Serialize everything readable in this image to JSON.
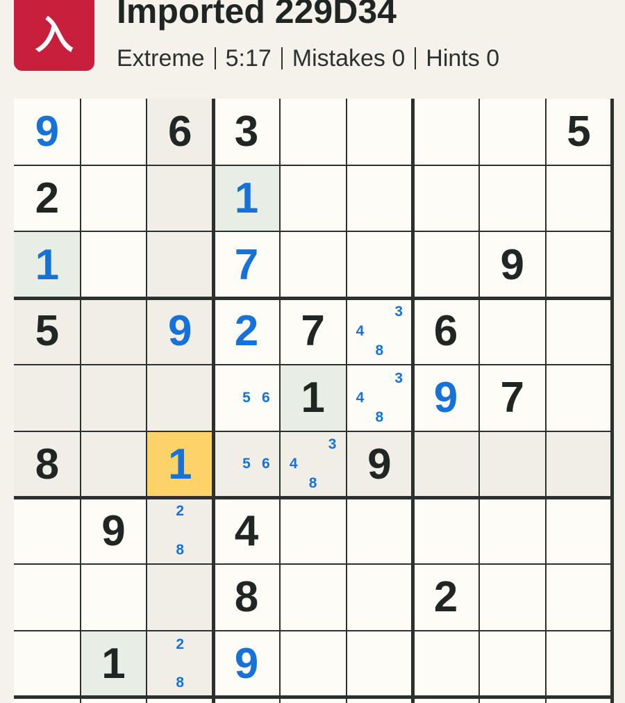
{
  "app": {
    "logo_glyph": "入",
    "title": "Imported 229D34",
    "difficulty": "Extreme",
    "timer": "5:17",
    "mistakes": "Mistakes 0",
    "hints": "Hints 0"
  },
  "colors": {
    "logo_bg": "#c8203c",
    "given_digit": "#1f2623",
    "user_digit": "#1672d9",
    "selected_cell": "#fcd269",
    "peer_highlight": "#f0eee7",
    "same_number_highlight": "#e8eee6"
  },
  "board": {
    "selected": [
      5,
      2
    ],
    "cells": [
      [
        {
          "v": "9",
          "t": "user"
        },
        {
          "v": "",
          "t": "empty"
        },
        {
          "v": "6",
          "t": "given",
          "hl": "peer"
        },
        {
          "v": "3",
          "t": "given"
        },
        {
          "v": "",
          "t": "empty"
        },
        {
          "v": "",
          "t": "empty"
        },
        {
          "v": "",
          "t": "empty"
        },
        {
          "v": "",
          "t": "empty"
        },
        {
          "v": "5",
          "t": "given"
        }
      ],
      [
        {
          "v": "2",
          "t": "given"
        },
        {
          "v": "",
          "t": "empty"
        },
        {
          "v": "",
          "t": "empty",
          "hl": "peer"
        },
        {
          "v": "1",
          "t": "user",
          "hl": "same"
        },
        {
          "v": "",
          "t": "empty"
        },
        {
          "v": "",
          "t": "empty"
        },
        {
          "v": "",
          "t": "empty"
        },
        {
          "v": "",
          "t": "empty"
        },
        {
          "v": "",
          "t": "empty"
        }
      ],
      [
        {
          "v": "1",
          "t": "user",
          "hl": "same"
        },
        {
          "v": "",
          "t": "empty"
        },
        {
          "v": "",
          "t": "empty",
          "hl": "peer"
        },
        {
          "v": "7",
          "t": "user"
        },
        {
          "v": "",
          "t": "empty"
        },
        {
          "v": "",
          "t": "empty"
        },
        {
          "v": "",
          "t": "empty"
        },
        {
          "v": "9",
          "t": "given"
        },
        {
          "v": "",
          "t": "empty"
        }
      ],
      [
        {
          "v": "5",
          "t": "given",
          "hl": "peer"
        },
        {
          "v": "",
          "t": "empty",
          "hl": "peer"
        },
        {
          "v": "9",
          "t": "user",
          "hl": "peer"
        },
        {
          "v": "2",
          "t": "user"
        },
        {
          "v": "7",
          "t": "given"
        },
        {
          "v": "",
          "t": "notes",
          "notes": [
            "3",
            "4",
            "8"
          ]
        },
        {
          "v": "6",
          "t": "given"
        },
        {
          "v": "",
          "t": "empty"
        },
        {
          "v": "",
          "t": "empty"
        }
      ],
      [
        {
          "v": "",
          "t": "empty",
          "hl": "peer"
        },
        {
          "v": "",
          "t": "empty",
          "hl": "peer"
        },
        {
          "v": "",
          "t": "empty",
          "hl": "peer"
        },
        {
          "v": "",
          "t": "notes",
          "notes": [
            "5",
            "6"
          ]
        },
        {
          "v": "1",
          "t": "given",
          "hl": "same"
        },
        {
          "v": "",
          "t": "notes",
          "notes": [
            "3",
            "4",
            "8"
          ]
        },
        {
          "v": "9",
          "t": "user"
        },
        {
          "v": "7",
          "t": "given"
        },
        {
          "v": "",
          "t": "empty"
        }
      ],
      [
        {
          "v": "8",
          "t": "given",
          "hl": "peer"
        },
        {
          "v": "",
          "t": "empty",
          "hl": "peer"
        },
        {
          "v": "1",
          "t": "user",
          "hl": "sel"
        },
        {
          "v": "",
          "t": "notes",
          "notes": [
            "5",
            "6"
          ],
          "hl": "peer"
        },
        {
          "v": "",
          "t": "notes",
          "notes": [
            "3",
            "4",
            "8"
          ],
          "hl": "peer"
        },
        {
          "v": "9",
          "t": "given",
          "hl": "peer"
        },
        {
          "v": "",
          "t": "empty",
          "hl": "peer"
        },
        {
          "v": "",
          "t": "empty",
          "hl": "peer"
        },
        {
          "v": "",
          "t": "empty",
          "hl": "peer"
        }
      ],
      [
        {
          "v": "",
          "t": "empty"
        },
        {
          "v": "9",
          "t": "given"
        },
        {
          "v": "",
          "t": "notes",
          "notes": [
            "2",
            "8"
          ],
          "hl": "peer"
        },
        {
          "v": "4",
          "t": "given"
        },
        {
          "v": "",
          "t": "empty"
        },
        {
          "v": "",
          "t": "empty"
        },
        {
          "v": "",
          "t": "empty"
        },
        {
          "v": "",
          "t": "empty"
        },
        {
          "v": "",
          "t": "empty"
        }
      ],
      [
        {
          "v": "",
          "t": "empty"
        },
        {
          "v": "",
          "t": "empty"
        },
        {
          "v": "",
          "t": "empty",
          "hl": "peer"
        },
        {
          "v": "8",
          "t": "given"
        },
        {
          "v": "",
          "t": "empty"
        },
        {
          "v": "",
          "t": "empty"
        },
        {
          "v": "2",
          "t": "given"
        },
        {
          "v": "",
          "t": "empty"
        },
        {
          "v": "",
          "t": "empty"
        }
      ],
      [
        {
          "v": "",
          "t": "empty"
        },
        {
          "v": "1",
          "t": "given",
          "hl": "same"
        },
        {
          "v": "",
          "t": "notes",
          "notes": [
            "2",
            "8"
          ],
          "hl": "peer"
        },
        {
          "v": "9",
          "t": "user"
        },
        {
          "v": "",
          "t": "empty"
        },
        {
          "v": "",
          "t": "empty"
        },
        {
          "v": "",
          "t": "empty"
        },
        {
          "v": "",
          "t": "empty"
        },
        {
          "v": "",
          "t": "empty"
        }
      ]
    ]
  }
}
